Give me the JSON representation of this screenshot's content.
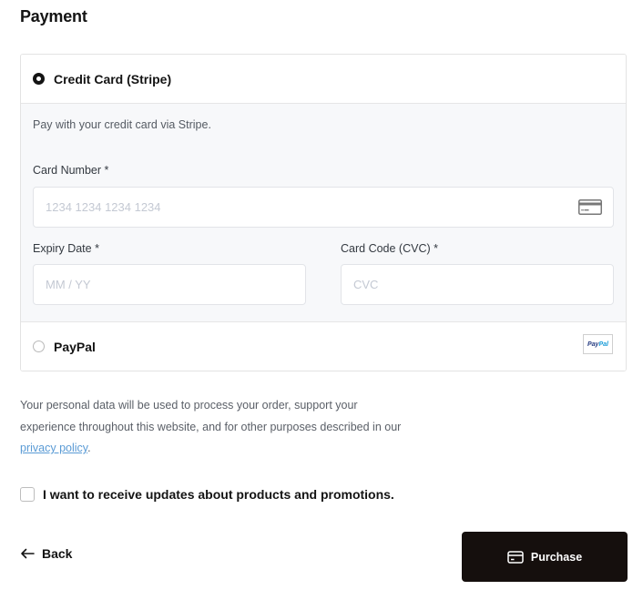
{
  "header": {
    "title": "Payment"
  },
  "payment_methods": [
    {
      "id": "stripe",
      "label": "Credit Card (Stripe)",
      "selected": true,
      "description": "Pay with your credit card via Stripe.",
      "fields": {
        "card_number": {
          "label": "Card Number *",
          "placeholder": "1234 1234 1234 1234",
          "value": "",
          "icon": "credit-card-icon"
        },
        "expiry": {
          "label": "Expiry Date *",
          "placeholder": "MM / YY",
          "value": ""
        },
        "cvc": {
          "label": "Card Code (CVC) *",
          "placeholder": "CVC",
          "value": ""
        }
      }
    },
    {
      "id": "paypal",
      "label": "PayPal",
      "selected": false,
      "logo_text_pay": "Pay",
      "logo_text_pal": "Pal"
    }
  ],
  "privacy": {
    "text_before": "Your personal data will be used to process your order, support your experience throughout this website, and for other purposes described in our ",
    "link_label": "privacy policy",
    "text_after": "."
  },
  "newsletter": {
    "label": "I want to receive updates about products and promotions.",
    "checked": false
  },
  "actions": {
    "back_label": "Back",
    "back_icon": "arrow-left-icon",
    "purchase_label": "Purchase",
    "purchase_icon": "credit-card-icon"
  },
  "colors": {
    "primary_button": "#150f0d",
    "link": "#5a9bd5",
    "panel_bg": "#f7f8fa",
    "border": "#e3e3e3"
  }
}
